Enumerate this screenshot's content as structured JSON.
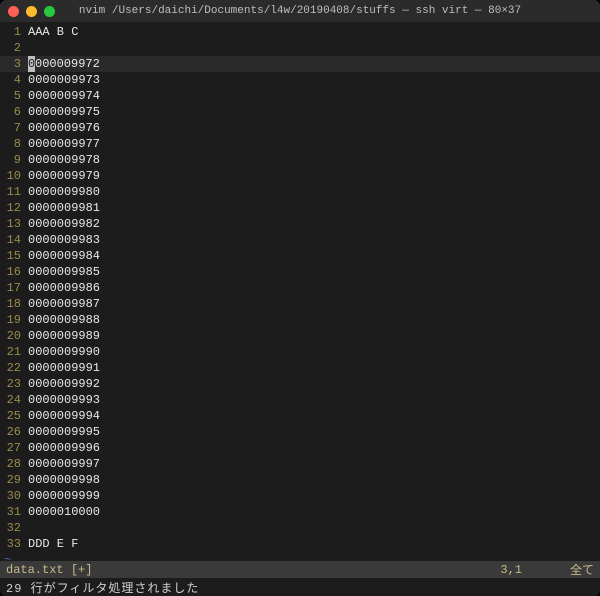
{
  "window": {
    "title": "nvim  /Users/daichi/Documents/l4w/20190408/stuffs — ssh virt — 80×37"
  },
  "buffer": {
    "current_line": 3,
    "lines": [
      {
        "n": 1,
        "text": "AAA B C"
      },
      {
        "n": 2,
        "text": ""
      },
      {
        "n": 3,
        "text": "0000009972"
      },
      {
        "n": 4,
        "text": "0000009973"
      },
      {
        "n": 5,
        "text": "0000009974"
      },
      {
        "n": 6,
        "text": "0000009975"
      },
      {
        "n": 7,
        "text": "0000009976"
      },
      {
        "n": 8,
        "text": "0000009977"
      },
      {
        "n": 9,
        "text": "0000009978"
      },
      {
        "n": 10,
        "text": "0000009979"
      },
      {
        "n": 11,
        "text": "0000009980"
      },
      {
        "n": 12,
        "text": "0000009981"
      },
      {
        "n": 13,
        "text": "0000009982"
      },
      {
        "n": 14,
        "text": "0000009983"
      },
      {
        "n": 15,
        "text": "0000009984"
      },
      {
        "n": 16,
        "text": "0000009985"
      },
      {
        "n": 17,
        "text": "0000009986"
      },
      {
        "n": 18,
        "text": "0000009987"
      },
      {
        "n": 19,
        "text": "0000009988"
      },
      {
        "n": 20,
        "text": "0000009989"
      },
      {
        "n": 21,
        "text": "0000009990"
      },
      {
        "n": 22,
        "text": "0000009991"
      },
      {
        "n": 23,
        "text": "0000009992"
      },
      {
        "n": 24,
        "text": "0000009993"
      },
      {
        "n": 25,
        "text": "0000009994"
      },
      {
        "n": 26,
        "text": "0000009995"
      },
      {
        "n": 27,
        "text": "0000009996"
      },
      {
        "n": 28,
        "text": "0000009997"
      },
      {
        "n": 29,
        "text": "0000009998"
      },
      {
        "n": 30,
        "text": "0000009999"
      },
      {
        "n": 31,
        "text": "0000010000"
      },
      {
        "n": 32,
        "text": ""
      },
      {
        "n": 33,
        "text": "DDD E F"
      }
    ],
    "tilde": "~"
  },
  "status": {
    "filename": "data.txt",
    "modified": "[+]",
    "position": "3,1",
    "scroll": "全て"
  },
  "cmdline": {
    "message": "29 行がフィルタ処理されました"
  }
}
